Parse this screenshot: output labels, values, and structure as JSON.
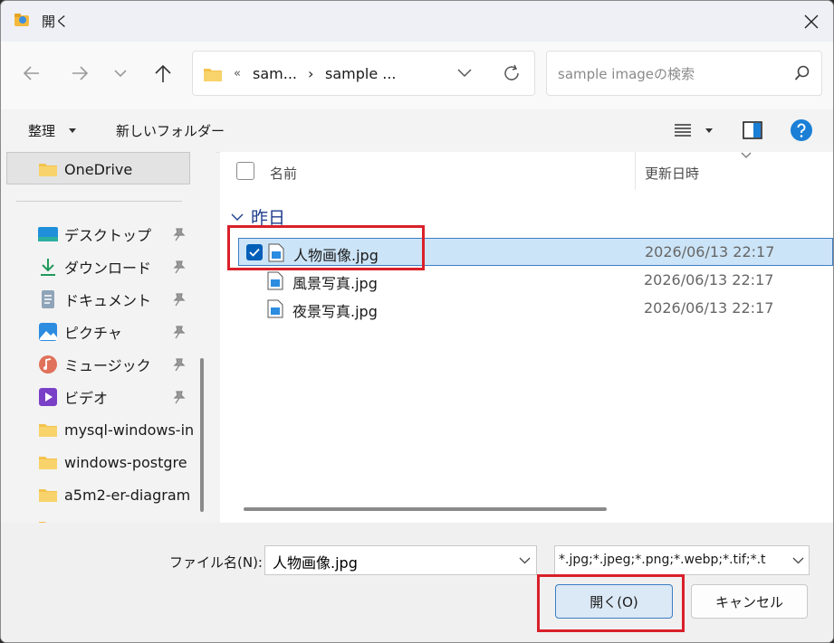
{
  "window": {
    "title": "開く",
    "close_icon": "close-icon"
  },
  "nav": {
    "crumb_overflow": "«",
    "crumb_1": "sam...",
    "crumb_sep": "›",
    "crumb_2": "sample ...",
    "search_placeholder": "sample imageの検索"
  },
  "toolbar": {
    "organize": "整理",
    "new_folder": "新しいフォルダー"
  },
  "sidebar": {
    "onedrive": "OneDrive",
    "items": [
      {
        "label": "デスクトップ",
        "icon": "desktop-icon"
      },
      {
        "label": "ダウンロード",
        "icon": "download-icon"
      },
      {
        "label": "ドキュメント",
        "icon": "documents-icon"
      },
      {
        "label": "ピクチャ",
        "icon": "pictures-icon"
      },
      {
        "label": "ミュージック",
        "icon": "music-icon"
      },
      {
        "label": "ビデオ",
        "icon": "videos-icon"
      },
      {
        "label": "mysql-windows-in",
        "icon": "folder-icon"
      },
      {
        "label": "windows-postgre",
        "icon": "folder-icon"
      },
      {
        "label": "a5m2-er-diagram",
        "icon": "folder-icon"
      }
    ]
  },
  "filelist": {
    "col_name": "名前",
    "col_date": "更新日時",
    "group": "昨日",
    "files": [
      {
        "name": "人物画像.jpg",
        "date": "2026/06/13 22:17",
        "selected": true
      },
      {
        "name": "風景写真.jpg",
        "date": "2026/06/13 22:17",
        "selected": false
      },
      {
        "name": "夜景写真.jpg",
        "date": "2026/06/13 22:17",
        "selected": false
      }
    ]
  },
  "bottom": {
    "filename_label": "ファイル名(N):",
    "filename_value": "人物画像.jpg",
    "filetype_value": "*.jpg;*.jpeg;*.png;*.webp;*.tif;*.t",
    "open_label": "開く(O)",
    "cancel_label": "キャンセル"
  },
  "colors": {
    "accent": "#005fb8",
    "highlight": "#d9202a",
    "selection": "#cce4f7"
  }
}
